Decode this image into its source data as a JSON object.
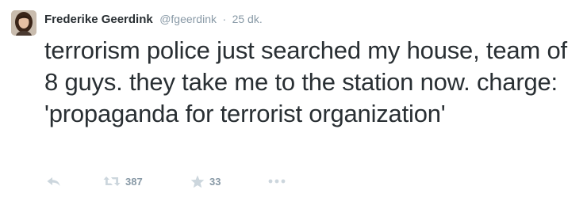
{
  "tweet": {
    "author": {
      "name": "Frederike Geerdink",
      "handle": "@fgeerdink"
    },
    "separator": "·",
    "timestamp": "25 dk.",
    "text": "terrorism police just searched my house, team of 8 guys. they take me to the station now. charge: 'propaganda for terrorist organization'",
    "actions": {
      "reply": {
        "icon": "reply-icon"
      },
      "retweet": {
        "icon": "retweet-icon",
        "count": "387"
      },
      "favorite": {
        "icon": "star-icon",
        "count": "33"
      },
      "more": {
        "icon": "more-icon"
      }
    }
  },
  "colors": {
    "text": "#292f33",
    "muted": "#8899a6",
    "icon": "#ccd6dd"
  }
}
